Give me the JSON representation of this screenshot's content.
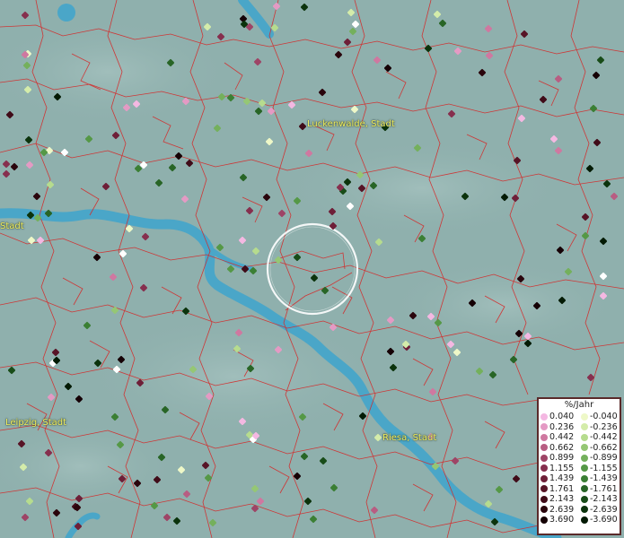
{
  "map": {
    "cities": [
      {
        "key": "luckenwalde",
        "label": "Luckenwalde, Stadt"
      },
      {
        "key": "stadt_left",
        "label": "Stadt"
      },
      {
        "key": "leipzig",
        "label": "Leipzig, Stadt"
      },
      {
        "key": "riesa",
        "label": "Riesa, Stadt"
      }
    ],
    "legend": {
      "title": "%/Jahr",
      "positive": [
        {
          "value": "0.040",
          "color": "#f4b8e2"
        },
        {
          "value": "0.236",
          "color": "#e49ac4"
        },
        {
          "value": "0.442",
          "color": "#cf78a0"
        },
        {
          "value": "0.662",
          "color": "#b85d82"
        },
        {
          "value": "0.899",
          "color": "#9e4466"
        },
        {
          "value": "1.155",
          "color": "#862f4e"
        },
        {
          "value": "1.439",
          "color": "#6e1f38"
        },
        {
          "value": "1.761",
          "color": "#571426"
        },
        {
          "value": "2.143",
          "color": "#400b18"
        },
        {
          "value": "2.639",
          "color": "#2a050c"
        },
        {
          "value": "3.690",
          "color": "#150105"
        }
      ],
      "negative": [
        {
          "value": "-0.040",
          "color": "#eef8c8"
        },
        {
          "value": "-0.236",
          "color": "#d4ecaa"
        },
        {
          "value": "-0.442",
          "color": "#b6dc8e"
        },
        {
          "value": "-0.662",
          "color": "#95c774"
        },
        {
          "value": "-0.899",
          "color": "#74b05c"
        },
        {
          "value": "-1.155",
          "color": "#559846"
        },
        {
          "value": "-1.439",
          "color": "#3b7f34"
        },
        {
          "value": "-1.761",
          "color": "#286526"
        },
        {
          "value": "-2.143",
          "color": "#184c18"
        },
        {
          "value": "-2.639",
          "color": "#0b330c"
        },
        {
          "value": "-3.690",
          "color": "#031a04"
        }
      ]
    },
    "colors": {
      "background": "#8fb0ad",
      "river": "#4aa6c8",
      "borders": "#d42a2a",
      "city_label": "#f2f060",
      "selection_ring": "#ffffff"
    }
  }
}
